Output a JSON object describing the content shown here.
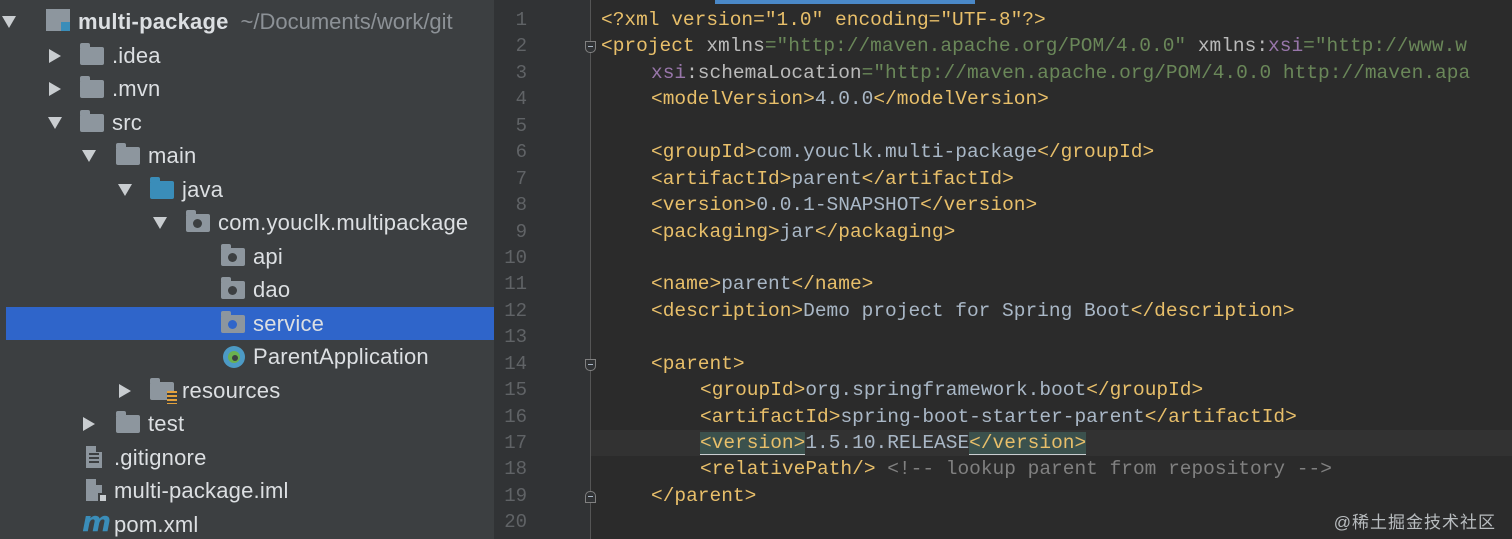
{
  "tree": {
    "root": {
      "name": "multi-package",
      "path": "~/Documents/work/git"
    },
    "items": [
      {
        "label": ".idea"
      },
      {
        "label": ".mvn"
      },
      {
        "label": "src"
      },
      {
        "label": "main"
      },
      {
        "label": "java"
      },
      {
        "label": "com.youclk.multipackage"
      },
      {
        "label": "api"
      },
      {
        "label": "dao"
      },
      {
        "label": "service"
      },
      {
        "label": "ParentApplication"
      },
      {
        "label": "resources"
      },
      {
        "label": "test"
      },
      {
        "label": ".gitignore"
      },
      {
        "label": "multi-package.iml"
      },
      {
        "label": "pom.xml"
      }
    ]
  },
  "editor": {
    "line_numbers": [
      "1",
      "2",
      "3",
      "4",
      "5",
      "6",
      "7",
      "8",
      "9",
      "10",
      "11",
      "12",
      "13",
      "14",
      "15",
      "16",
      "17",
      "18",
      "19",
      "20"
    ],
    "lines": [
      [
        "<?xml version=\"1.0\" encoding=\"UTF-8\"?>"
      ],
      [
        "<project",
        " xmlns",
        "=\"http://maven.apache.org/POM/4.0.0\"",
        " xmlns",
        ":",
        "xsi",
        "=\"http://www.w"
      ],
      [
        "xsi",
        ":schemaLocation",
        "=\"http://maven.apache.org/POM/4.0.0 http://maven.apa"
      ],
      [
        "<modelVersion>",
        "4.0.0",
        "</modelVersion>"
      ],
      [],
      [
        "<groupId>",
        "com.youclk.multi-package",
        "</groupId>"
      ],
      [
        "<artifactId>",
        "parent",
        "</artifactId>"
      ],
      [
        "<version>",
        "0.0.1-SNAPSHOT",
        "</version>"
      ],
      [
        "<packaging>",
        "jar",
        "</packaging>"
      ],
      [],
      [
        "<name>",
        "parent",
        "</name>"
      ],
      [
        "<description>",
        "Demo project for Spring Boot",
        "</description>"
      ],
      [],
      [
        "<parent>"
      ],
      [
        "<groupId>",
        "org.springframework.boot",
        "</groupId>"
      ],
      [
        "<artifactId>",
        "spring-boot-starter-parent",
        "</artifactId>"
      ],
      [
        "<version>",
        "1.5.10.RELEASE",
        "</version>"
      ],
      [
        "<relativePath/>",
        " <!-- lookup parent from repository -->"
      ],
      [
        "</parent>"
      ],
      []
    ]
  },
  "watermark": "@稀土掘金技术社区",
  "colors": {
    "tree_bg": "#3C3F41",
    "selection": "#2F65CA",
    "editor_bg": "#2B2B2B",
    "tag": "#E8BF6A",
    "string": "#6A8759",
    "text": "#A9B7C6"
  }
}
